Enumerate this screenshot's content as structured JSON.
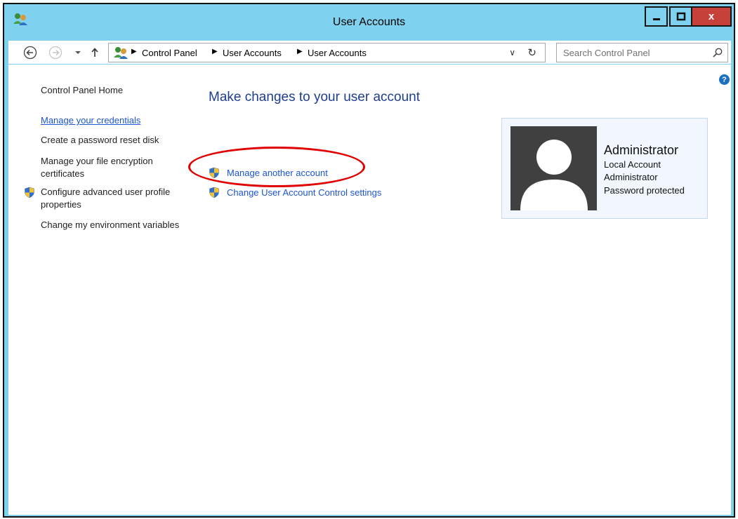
{
  "window": {
    "title": "User Accounts",
    "close_label": "x"
  },
  "navbar": {
    "breadcrumb": [
      "Control Panel",
      "User Accounts",
      "User Accounts"
    ],
    "search_placeholder": "Search Control Panel"
  },
  "sidebar": {
    "home": "Control Panel Home",
    "items": [
      "Manage your credentials",
      "Create a password reset disk",
      "Manage your file encryption certificates",
      "Configure advanced user profile properties",
      "Change my environment variables"
    ]
  },
  "main": {
    "heading": "Make changes to your user account",
    "tasks": [
      "Manage another account",
      "Change User Account Control settings"
    ]
  },
  "account": {
    "name": "Administrator",
    "lines": [
      "Local Account",
      "Administrator",
      "Password protected"
    ]
  },
  "icons": {
    "title": "users-icon",
    "back": "back-arrow-icon",
    "forward": "forward-arrow-icon",
    "recent": "chevron-down-icon",
    "up": "up-arrow-icon",
    "refresh": "refresh-icon",
    "search": "search-icon",
    "help": "help-icon",
    "shield": "uac-shield-icon"
  },
  "colors": {
    "titlebar": "#7fd2ef",
    "link": "#1c55cf",
    "heading": "#1e3d8f",
    "close_button": "#c7403a",
    "highlight": "#e00000"
  }
}
